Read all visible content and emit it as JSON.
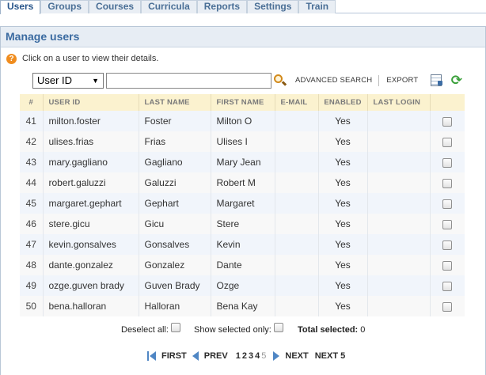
{
  "tabs": [
    {
      "label": "Users",
      "active": true
    },
    {
      "label": "Groups",
      "active": false
    },
    {
      "label": "Courses",
      "active": false
    },
    {
      "label": "Curricula",
      "active": false
    },
    {
      "label": "Reports",
      "active": false
    },
    {
      "label": "Settings",
      "active": false
    },
    {
      "label": "Train",
      "active": false
    }
  ],
  "panel": {
    "title": "Manage users",
    "hint": "Click on a user to view their details."
  },
  "search": {
    "field_selected": "User ID",
    "query": "",
    "advanced_label": "ADVANCED SEARCH",
    "export_label": "EXPORT"
  },
  "table": {
    "columns": [
      "#",
      "USER ID",
      "LAST NAME",
      "FIRST NAME",
      "E-MAIL",
      "ENABLED",
      "LAST LOGIN",
      ""
    ],
    "rows": [
      {
        "num": "41",
        "user_id": "milton.foster",
        "last": "Foster",
        "first": "Milton O",
        "email": "",
        "enabled": "Yes",
        "last_login": ""
      },
      {
        "num": "42",
        "user_id": "ulises.frias",
        "last": "Frias",
        "first": "Ulises I",
        "email": "",
        "enabled": "Yes",
        "last_login": ""
      },
      {
        "num": "43",
        "user_id": "mary.gagliano",
        "last": "Gagliano",
        "first": "Mary Jean",
        "email": "",
        "enabled": "Yes",
        "last_login": ""
      },
      {
        "num": "44",
        "user_id": "robert.galuzzi",
        "last": "Galuzzi",
        "first": "Robert M",
        "email": "",
        "enabled": "Yes",
        "last_login": ""
      },
      {
        "num": "45",
        "user_id": "margaret.gephart",
        "last": "Gephart",
        "first": "Margaret",
        "email": "",
        "enabled": "Yes",
        "last_login": ""
      },
      {
        "num": "46",
        "user_id": "stere.gicu",
        "last": "Gicu",
        "first": "Stere",
        "email": "",
        "enabled": "Yes",
        "last_login": ""
      },
      {
        "num": "47",
        "user_id": "kevin.gonsalves",
        "last": "Gonsalves",
        "first": "Kevin",
        "email": "",
        "enabled": "Yes",
        "last_login": ""
      },
      {
        "num": "48",
        "user_id": "dante.gonzalez",
        "last": "Gonzalez",
        "first": "Dante",
        "email": "",
        "enabled": "Yes",
        "last_login": ""
      },
      {
        "num": "49",
        "user_id": "ozge.guven brady",
        "last": "Guven Brady",
        "first": "Ozge",
        "email": "",
        "enabled": "Yes",
        "last_login": ""
      },
      {
        "num": "50",
        "user_id": "bena.halloran",
        "last": "Halloran",
        "first": "Bena Kay",
        "email": "",
        "enabled": "Yes",
        "last_login": ""
      }
    ]
  },
  "footer": {
    "deselect_label": "Deselect all:",
    "show_selected_label": "Show selected only:",
    "total_label": "Total selected:",
    "total_value": "0"
  },
  "pager": {
    "first": "FIRST",
    "prev": "PREV",
    "pages": [
      "1",
      "2",
      "3",
      "4",
      "5"
    ],
    "current": "5",
    "next": "NEXT",
    "next5": "NEXT 5"
  },
  "colors": {
    "accent": "#3a6aa0",
    "header_bg": "#fbf2cf",
    "pager_arrow": "#4f86c4",
    "hint_icon": "#f08d1f",
    "refresh_icon": "#3aa03a"
  },
  "icons": {
    "hint": "question-icon",
    "search": "magnifier-icon",
    "columns": "grid-settings-icon",
    "refresh": "refresh-icon"
  }
}
